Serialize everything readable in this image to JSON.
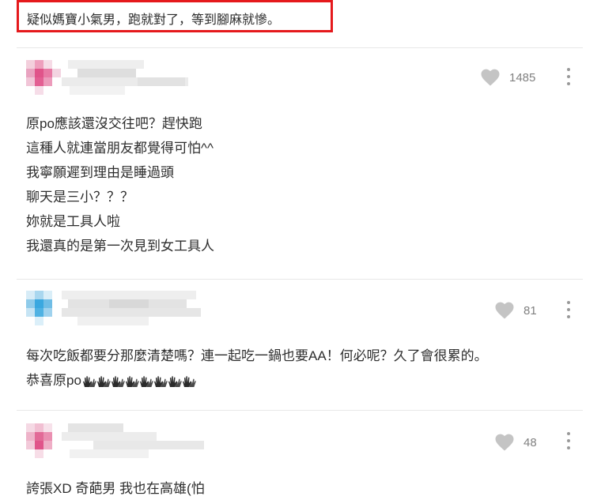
{
  "highlighted_comment": {
    "text": "疑似媽寶小氣男，跑就對了，等到腳麻就慘。"
  },
  "comments": [
    {
      "likes": "1485",
      "lines": [
        "原po應該還沒交往吧？趕快跑",
        "這種人就連當朋友都覺得可怕^^",
        "我寧願遲到理由是睡過頭",
        "聊天是三小？？？",
        "妳就是工具人啦",
        "我還真的是第一次見到女工具人"
      ],
      "avatar_color": "#e0548a"
    },
    {
      "likes": "81",
      "lines": [
        "每次吃飯都要分那麼清楚嗎？連一起吃一鍋也要AA！何必呢？久了會很累的。",
        "恭喜原po"
      ],
      "avatar_color": "#3aa8e0",
      "clap_icon_count": 8
    },
    {
      "likes": "48",
      "lines": [
        "誇張XD  奇葩男  我也在高雄(怕"
      ],
      "avatar_color": "#e0548a"
    }
  ],
  "icons": {
    "like": "heart-icon",
    "more": "more-vertical-icon",
    "clap": "clapping-hands-icon"
  },
  "colors": {
    "highlight_border": "#e5191c",
    "icon_gray": "#c4c4c4",
    "count_gray": "#808080"
  }
}
